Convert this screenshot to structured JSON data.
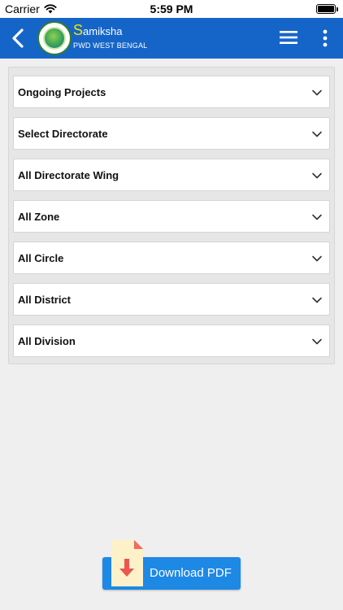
{
  "status_bar": {
    "carrier": "Carrier",
    "time": "5:59 PM",
    "battery_level": 1.0
  },
  "header": {
    "title_initial": "S",
    "title_rest": "amiksha",
    "subtitle": "PWD WEST BENGAL",
    "back_icon": "chevron-left-icon",
    "menu_icon": "hamburger-icon",
    "more_icon": "more-vertical-icon",
    "background_color": "#1565c9",
    "title_accent_color": "#f5e400"
  },
  "filters": [
    {
      "label": "Ongoing Projects"
    },
    {
      "label": "Select Directorate"
    },
    {
      "label": "All Directorate Wing"
    },
    {
      "label": "All Zone"
    },
    {
      "label": "All Circle"
    },
    {
      "label": "All District"
    },
    {
      "label": "All Division"
    }
  ],
  "download": {
    "label": "Download PDF",
    "icon": "pdf-download-icon",
    "button_color": "#1e88e5"
  }
}
